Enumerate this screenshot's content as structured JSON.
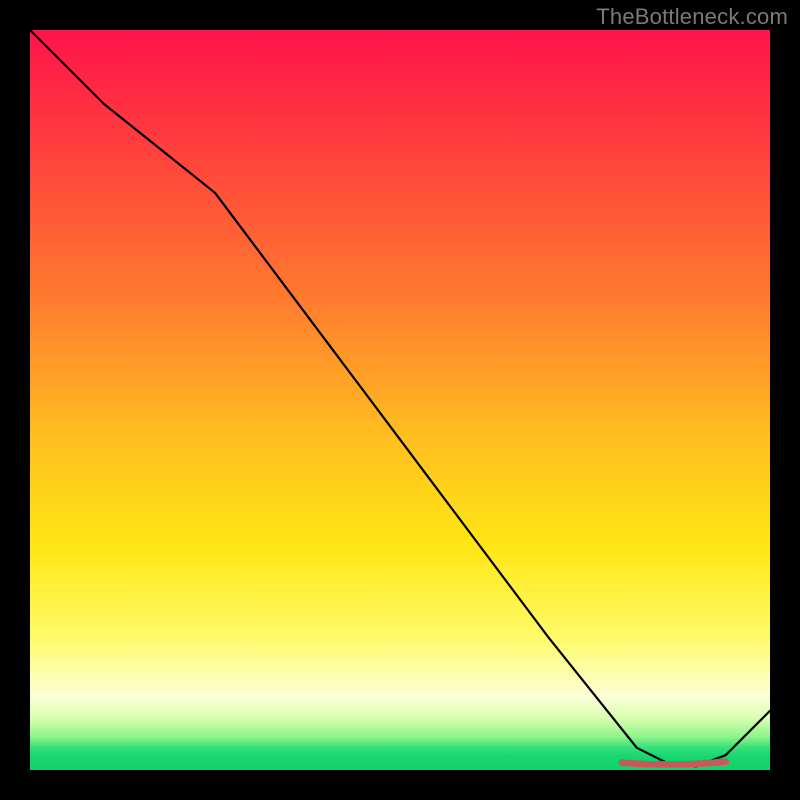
{
  "watermark": "TheBottleneck.com",
  "colors": {
    "background": "#000000",
    "line": "#000000",
    "marker": "#c65a5a",
    "gradient_top": "#ff144a",
    "gradient_bottom": "#14d06a"
  },
  "chart_data": {
    "type": "line",
    "title": "",
    "xlabel": "",
    "ylabel": "",
    "xlim": [
      0,
      100
    ],
    "ylim": [
      0,
      100
    ],
    "grid": false,
    "x": [
      0,
      10,
      25,
      40,
      55,
      70,
      78,
      82,
      86,
      90,
      94,
      100
    ],
    "values": [
      100,
      90,
      78,
      58,
      38,
      18,
      8,
      3,
      1,
      0.5,
      2,
      8
    ],
    "annotations": [
      {
        "kind": "dotted-segment",
        "x_from": 80,
        "x_to": 94,
        "y": 1,
        "color": "#c65a5a",
        "note": "flat minimum plateau marker"
      }
    ],
    "description": "Monotonically decreasing black curve over a vertical red→yellow→green heat gradient, reaching a near-zero plateau around x≈82–94 (marked with a short brick-red dotted worm), then turning back up slightly at the right edge."
  }
}
